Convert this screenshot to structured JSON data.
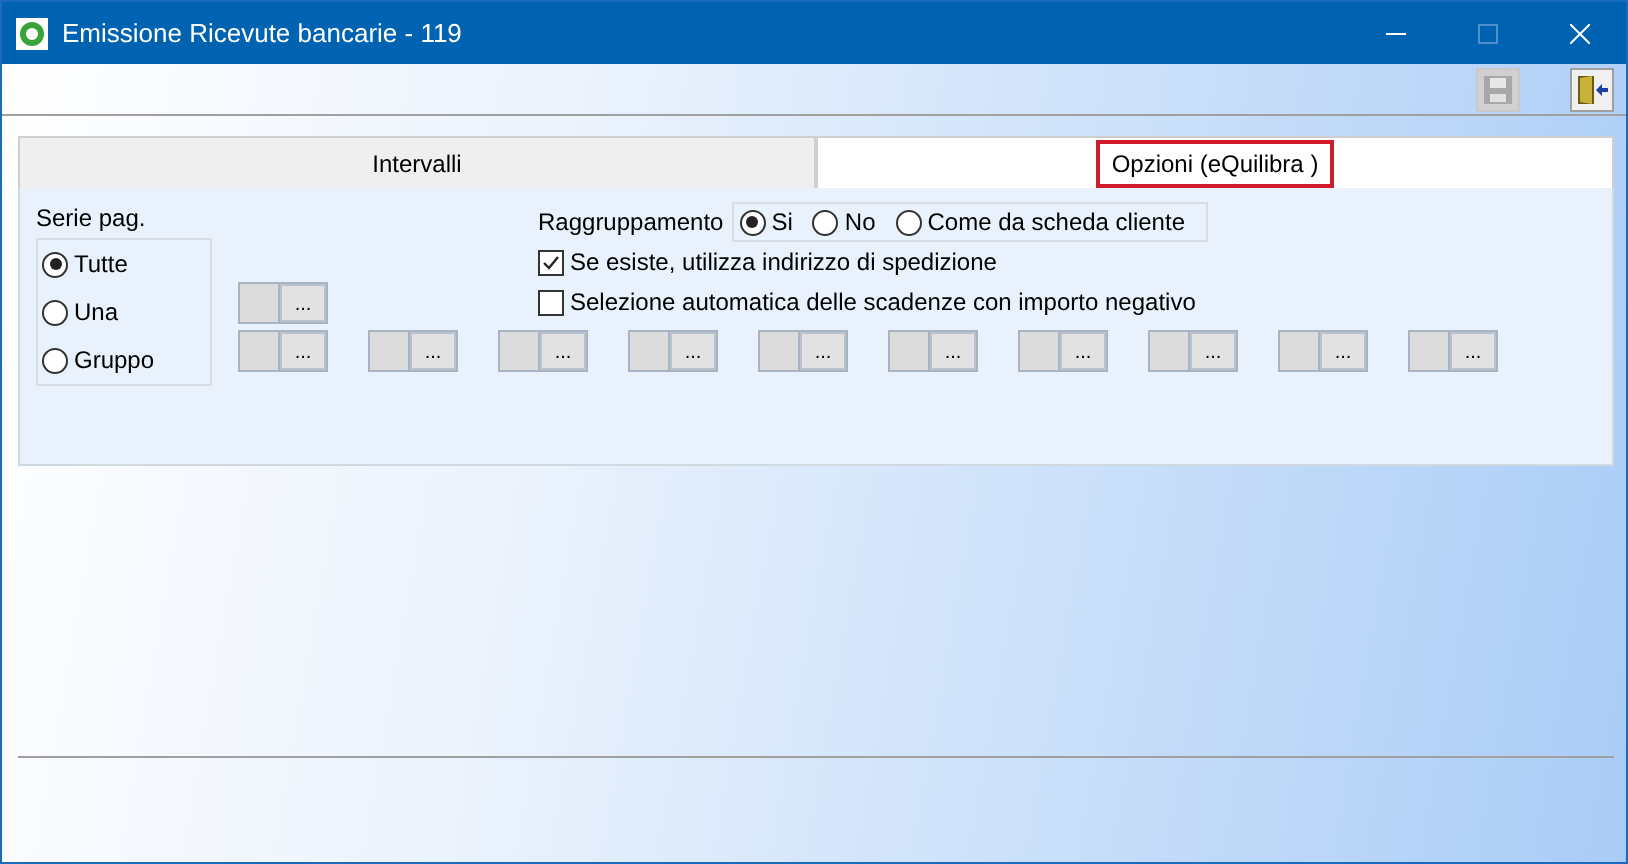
{
  "window": {
    "title": "Emissione Ricevute bancarie - 119"
  },
  "toolbar": [
    {
      "kind": "save",
      "disabled": true
    },
    {
      "kind": "exit",
      "disabled": false
    }
  ],
  "tabs": [
    {
      "label": "Intervalli",
      "selected": false,
      "highlighted": false
    },
    {
      "label": "Opzioni (eQuilibra )",
      "selected": true,
      "highlighted": true
    }
  ],
  "serie_pag": {
    "label": "Serie pag.",
    "options": [
      {
        "label": "Tutte",
        "selected": true
      },
      {
        "label": "Una",
        "selected": false
      },
      {
        "label": "Gruppo",
        "selected": false
      }
    ]
  },
  "raggruppamento": {
    "label": "Raggruppamento",
    "options": [
      {
        "label": "Si",
        "selected": true
      },
      {
        "label": "No",
        "selected": false
      },
      {
        "label": "Come da scheda cliente",
        "selected": false
      }
    ]
  },
  "checkboxes": [
    {
      "label": "Se esiste, utilizza indirizzo di spedizione",
      "checked": true
    },
    {
      "label": "Selezione automatica delle scadenze con importo negativo",
      "checked": false
    }
  ],
  "lookup_rows": [
    [
      "..."
    ],
    [
      "...",
      "...",
      "...",
      "...",
      "...",
      "...",
      "...",
      "...",
      "...",
      "..."
    ]
  ]
}
